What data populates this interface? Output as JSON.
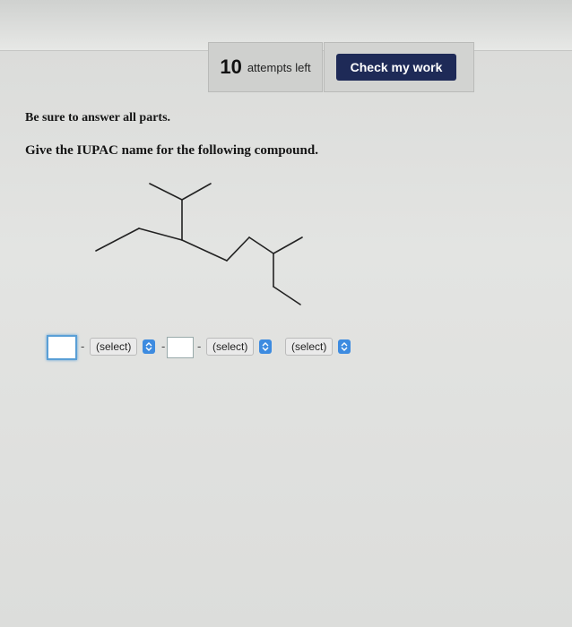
{
  "header": {
    "attempts_count": "10",
    "attempts_label": "attempts left",
    "check_button_label": "Check my work"
  },
  "content": {
    "instruction": "Be sure to answer all parts.",
    "question": "Give the IUPAC name for the following compound."
  },
  "answer": {
    "select_1": "(select)",
    "select_2": "(select)",
    "select_3": "(select)"
  },
  "colors": {
    "check_button": "#1e2a57",
    "stepper": "#3d8be0",
    "focus_ring": "#5a9fd6"
  }
}
